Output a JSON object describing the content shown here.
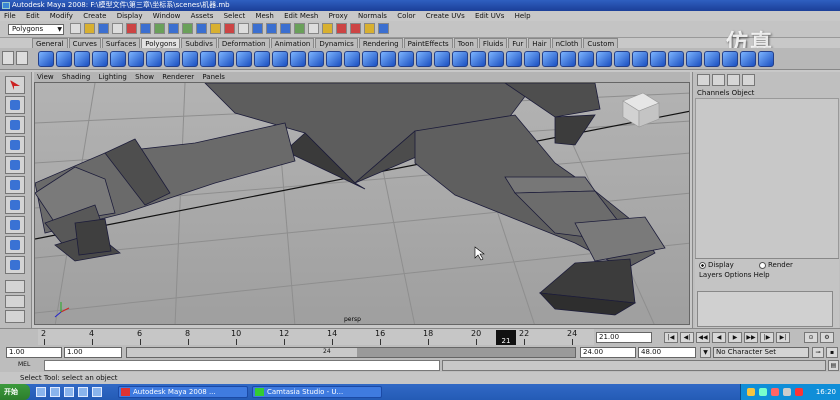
{
  "window": {
    "title": "Autodesk Maya 2008: F:\\模型文件\\第三章\\坐标系\\scenes\\机器.mb"
  },
  "menubar": {
    "items": [
      "File",
      "Edit",
      "Modify",
      "Create",
      "Display",
      "Window",
      "Assets",
      "Select",
      "Mesh",
      "Edit Mesh",
      "Proxy",
      "Normals",
      "Color",
      "Create UVs",
      "Edit UVs",
      "Help"
    ]
  },
  "status": {
    "mode": "Polygons"
  },
  "watermark": "仿真",
  "shelf": {
    "tabs": [
      "General",
      "Curves",
      "Surfaces",
      "Polygons",
      "Subdivs",
      "Deformation",
      "Animation",
      "Dynamics",
      "Rendering",
      "PaintEffects",
      "Toon",
      "Fluids",
      "Fur",
      "Hair",
      "nCloth",
      "Custom"
    ],
    "active": "Polygons"
  },
  "viewport": {
    "menu": [
      "View",
      "Shading",
      "Lighting",
      "Show",
      "Renderer",
      "Panels"
    ],
    "camera_label": "persp"
  },
  "channels": {
    "header": "Channels  Object"
  },
  "layers": {
    "display_label": "Display",
    "render_label": "Render",
    "menu": "Layers  Options  Help"
  },
  "timeline": {
    "ticks": [
      "2",
      "4",
      "6",
      "8",
      "10",
      "12",
      "14",
      "16",
      "18",
      "20",
      "22",
      "24"
    ],
    "current": "21",
    "current_frame_field": "21.00"
  },
  "range": {
    "start": "1.00",
    "playback_start": "1.00",
    "slider_value": "24",
    "playback_end": "24.00",
    "end": "48.00",
    "character_set": "No Character Set"
  },
  "command": {
    "label": "MEL"
  },
  "help": {
    "text": "Select Tool: select an object"
  },
  "taskbar": {
    "start": "开始",
    "tasks": [
      "Autodesk Maya 2008 ...",
      "Camtasia Studio - U..."
    ],
    "clock": "16:20"
  }
}
